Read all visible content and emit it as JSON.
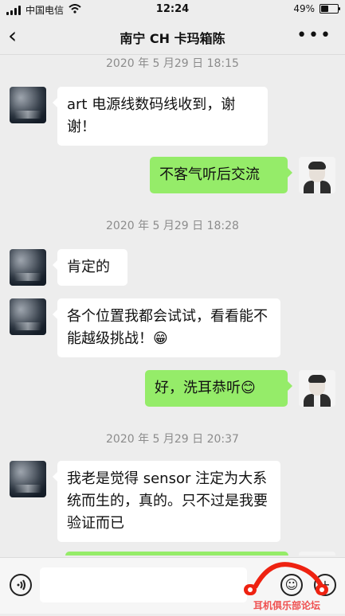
{
  "status_bar": {
    "carrier": "中国电信",
    "time": "12:24",
    "battery": "49%",
    "battery_level": 0.49
  },
  "nav": {
    "back_icon": "chevron-left",
    "title": "南宁 CH 卡玛箱陈",
    "more_icon": "more-dots"
  },
  "timestamps": [
    "2020 年 5 月29 日  18:15",
    "2020 年 5 月29 日  18:28",
    "2020 年 5 月29 日  20:37"
  ],
  "messages": [
    {
      "side": "left",
      "text": "art 电源线数码线收到，谢谢！"
    },
    {
      "side": "right",
      "text": "不客气听后交流"
    },
    {
      "side": "left",
      "text": "肯定的"
    },
    {
      "side": "left",
      "text": "各个位置我都会试试，看看能不能越级挑战！😁"
    },
    {
      "side": "right",
      "text": "好，洗耳恭听😊"
    },
    {
      "side": "left",
      "text": "我老是觉得 sensor 注定为大系统而生的，真的。只不过是我要验证而已"
    }
  ],
  "input_bar": {
    "voice_icon": "voice-icon",
    "emoji_icon": "emoji-icon",
    "plus_icon": "plus-icon",
    "input_value": "",
    "watermark_text": "耳机俱乐部论坛"
  }
}
